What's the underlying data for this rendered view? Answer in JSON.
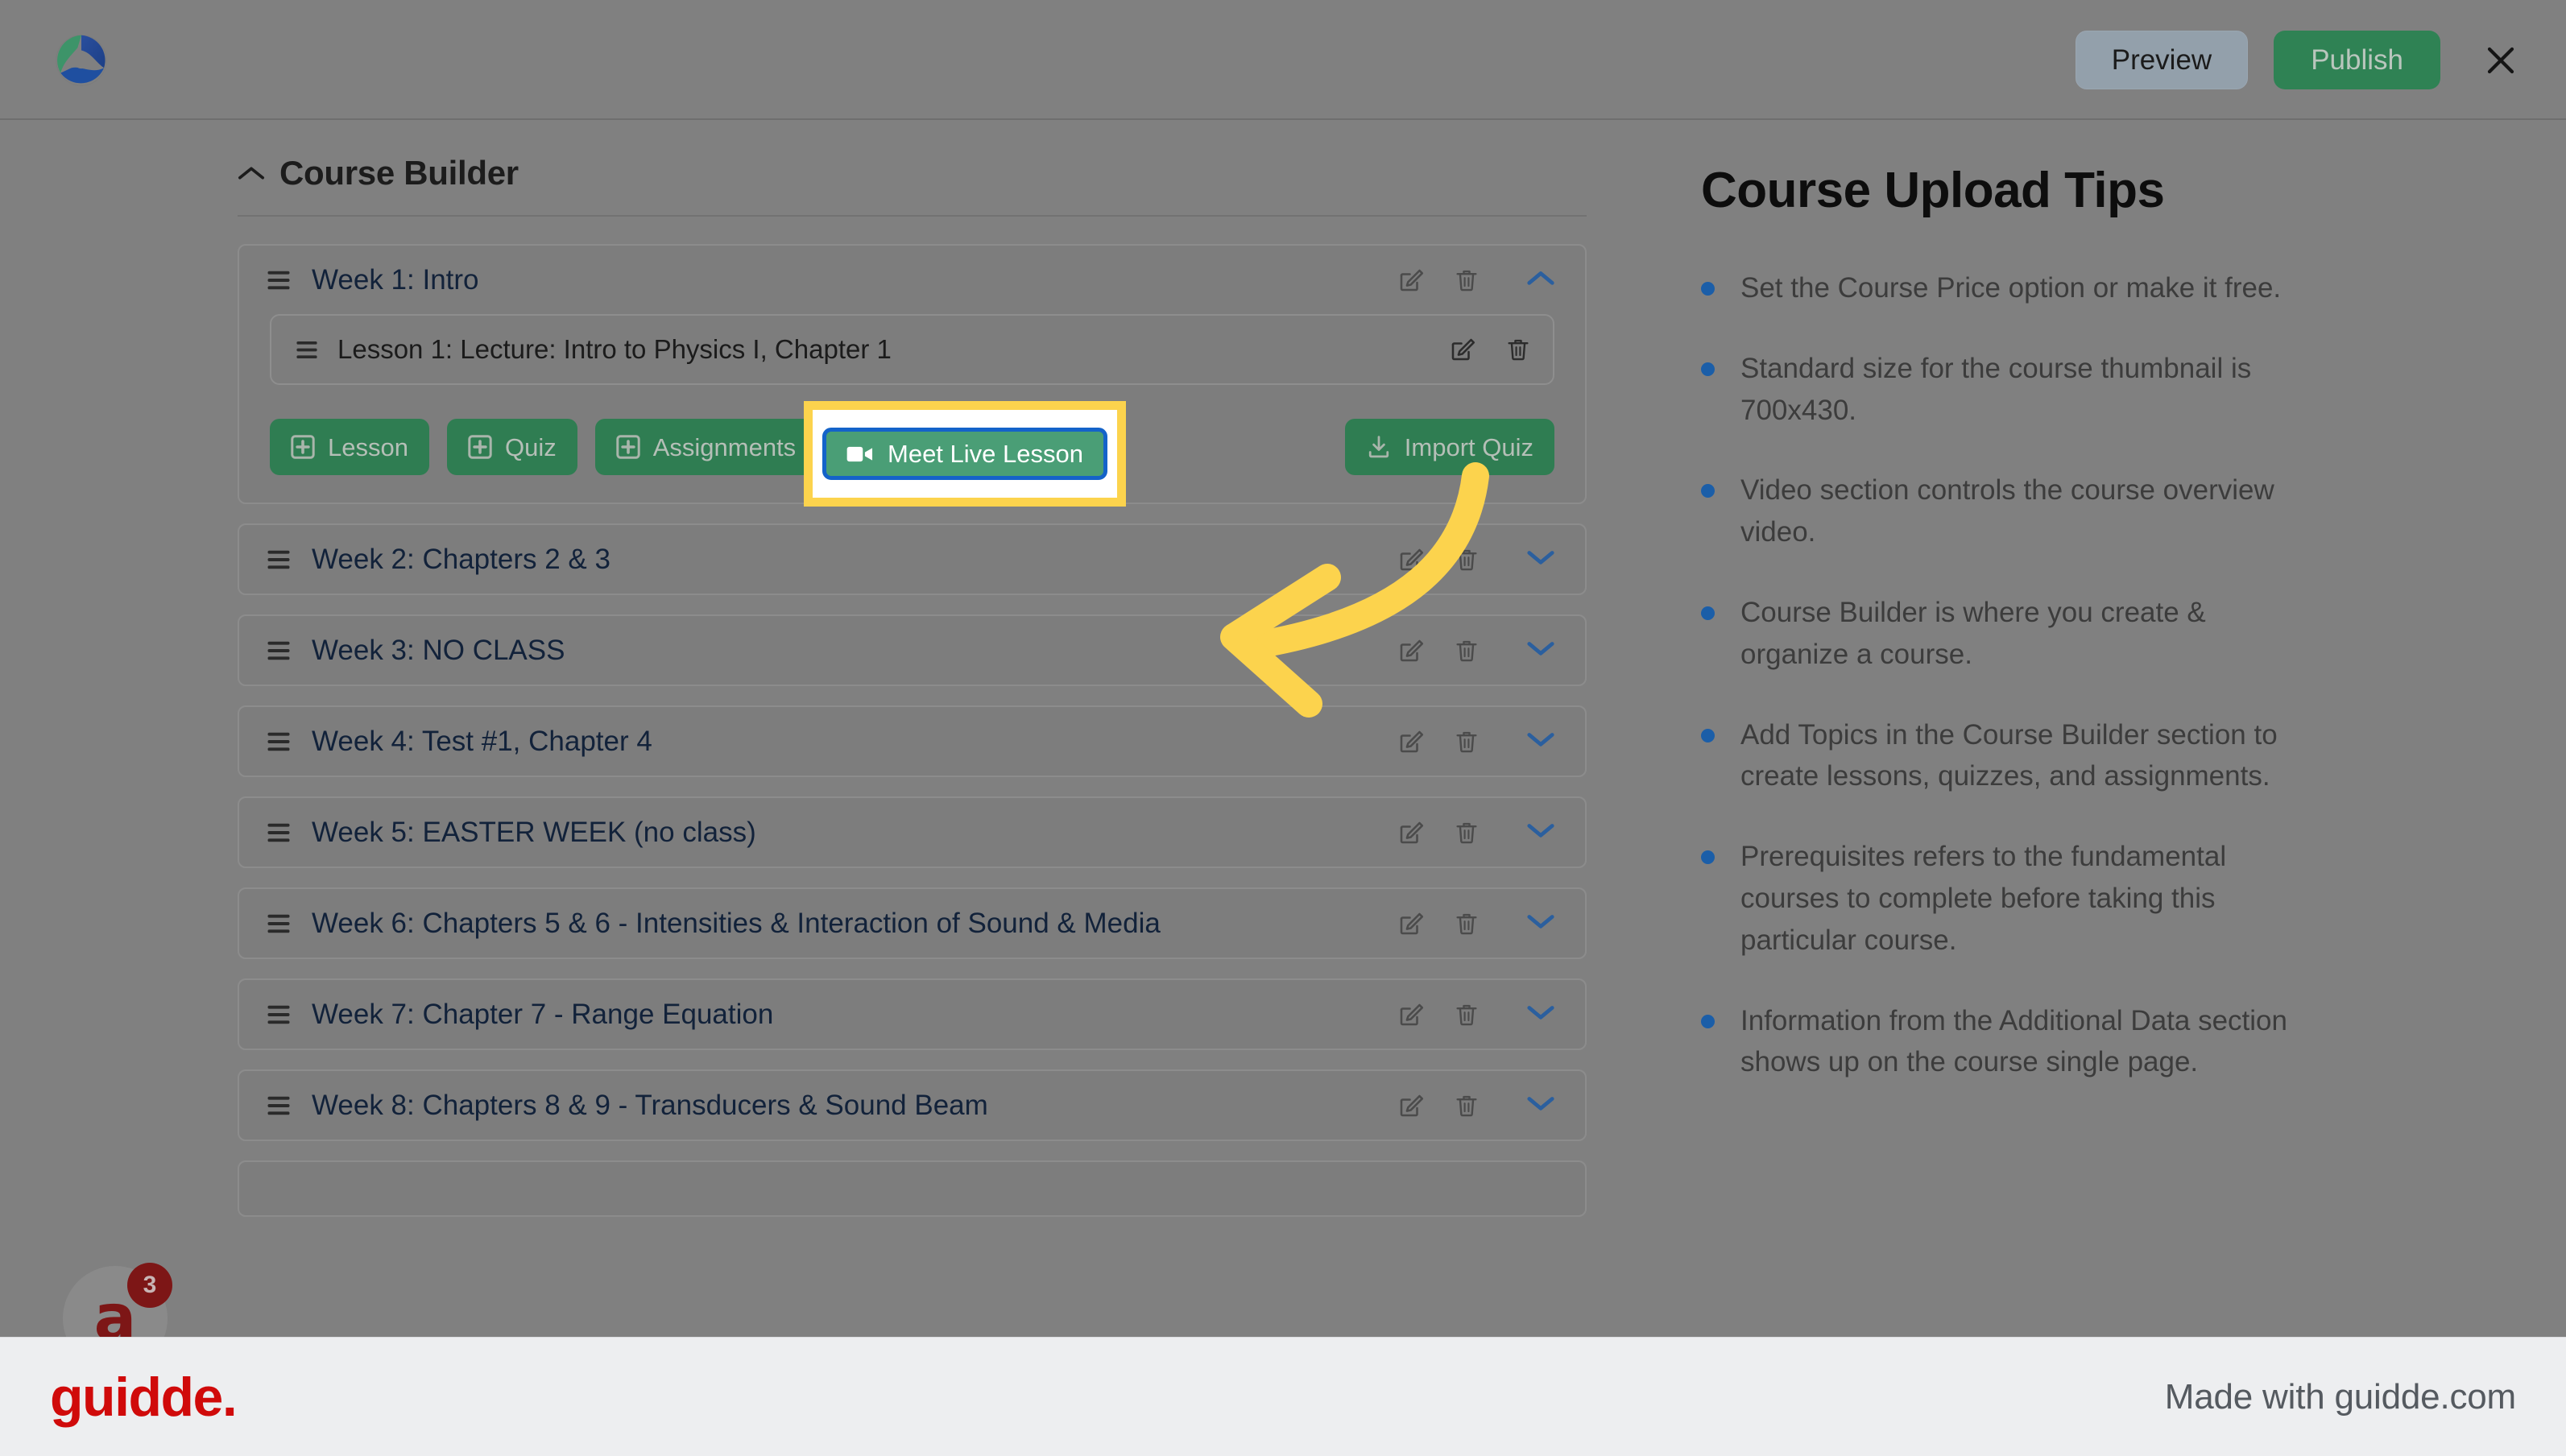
{
  "topbar": {
    "logo_icon": "circular-swirl-logo",
    "preview_label": "Preview",
    "publish_label": "Publish",
    "close_icon": "close-icon"
  },
  "course_builder": {
    "title": "Course Builder",
    "collapse_icon": "chevron-up-icon",
    "edit_icon": "edit-icon",
    "delete_icon": "trash-icon",
    "drag_icon": "drag-handle-icon",
    "expand_icon": "chevron-down-icon"
  },
  "weeks": [
    {
      "title": "Week 1: Intro",
      "expanded": true
    },
    {
      "title": "Week 2: Chapters 2 & 3",
      "expanded": false
    },
    {
      "title": "Week 3: NO CLASS",
      "expanded": false
    },
    {
      "title": "Week 4: Test #1, Chapter 4",
      "expanded": false
    },
    {
      "title": "Week 5: EASTER WEEK (no class)",
      "expanded": false
    },
    {
      "title": "Week 6: Chapters 5 & 6 - Intensities & Interaction of Sound & Media",
      "expanded": false
    },
    {
      "title": "Week 7: Chapter 7 - Range Equation",
      "expanded": false
    },
    {
      "title": "Week 8: Chapters 8 & 9 - Transducers & Sound Beam",
      "expanded": false
    }
  ],
  "week1": {
    "lesson_title": "Lesson 1: Lecture: Intro to Physics I, Chapter 1",
    "actions": [
      {
        "label": "Lesson",
        "icon": "plus-square-icon"
      },
      {
        "label": "Quiz",
        "icon": "plus-square-icon"
      },
      {
        "label": "Assignments",
        "icon": "plus-square-icon"
      }
    ],
    "meet_live_lesson": {
      "label": "Meet Live Lesson",
      "icon": "video-camera-icon"
    },
    "import_quiz": {
      "label": "Import Quiz",
      "icon": "download-icon"
    }
  },
  "tips": {
    "title": "Course Upload Tips",
    "items": [
      "Set the Course Price option or make it free.",
      "Standard size for the course thumbnail is 700x430.",
      "Video section controls the course overview video.",
      "Course Builder is where you create & organize a course.",
      "Add Topics in the Course Builder section to create lessons, quizzes, and assignments.",
      "Prerequisites refers to the fundamental courses to complete before taking this particular course.",
      "Information from the Additional Data section shows up on the course single page."
    ]
  },
  "help_widget": {
    "glyph": "a",
    "badge_count": "3"
  },
  "footer": {
    "logo_text": "guidde.",
    "made_with": "Made with guidde.com"
  },
  "annotation": {
    "arrow_icon": "curved-left-arrow-annotation",
    "highlight_color": "#fcd34d"
  },
  "colors": {
    "accent_green": "#2f7d52",
    "highlight_yellow": "#fcd34d",
    "focus_blue": "#1463c9",
    "bullet_blue": "#1b5ea8",
    "brand_red": "#d00a0a"
  }
}
